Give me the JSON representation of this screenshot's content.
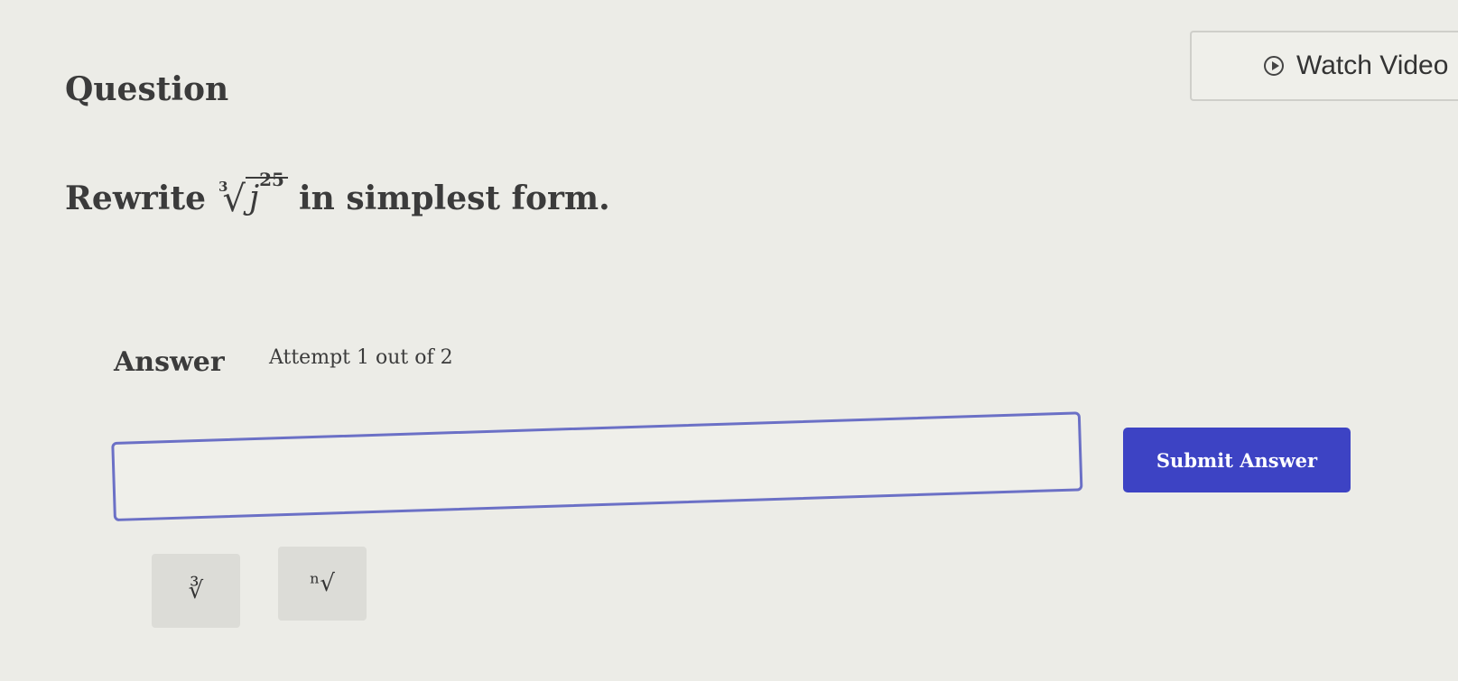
{
  "header": {
    "title": "Question",
    "watch_video_label": "Watch Video",
    "watch_video_icon": "play-icon"
  },
  "question": {
    "prefix": "Rewrite",
    "radical_index": "3",
    "radicand_base": "j",
    "radicand_exponent": "25",
    "suffix": "in simplest form."
  },
  "answer": {
    "heading": "Answer",
    "attempt": "Attempt 1 out of 2",
    "input_value": "",
    "submit_label": "Submit Answer"
  },
  "keypad": {
    "cube_root_label": "∛",
    "nth_root_label": "ⁿ√"
  },
  "colors": {
    "background": "#ecece7",
    "accent": "#3d43c4",
    "input_border": "#6b70c6"
  }
}
